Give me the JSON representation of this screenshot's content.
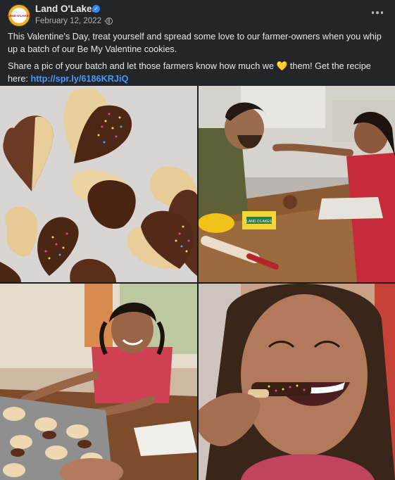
{
  "header": {
    "page_name": "Land O'Lakes",
    "avatar_text": "LAND O'LAKES",
    "date": "February 12, 2022 ·",
    "verified_icon": "verified-check-icon",
    "audience_icon": "globe-icon",
    "more_icon": "more-horizontal-icon"
  },
  "caption": {
    "line1": "This Valentine's Day, treat yourself and spread some love to our farmer-owners when you whip up a batch of our Be My Valentine cookies.",
    "line2_before": "Share a pic of your batch and let those farmers know how much we ",
    "heart_emoji": "💛",
    "line2_after": " them! Get the recipe here: ",
    "link": "http://spr.ly/6186KRJiQ"
  },
  "photos": [
    {
      "name": "heart-cookies-photo"
    },
    {
      "name": "father-daughter-kitchen-photo"
    },
    {
      "name": "girl-cookie-tray-photo"
    },
    {
      "name": "girl-eating-cookie-photo"
    }
  ],
  "product_label": "LAND O'LAKES",
  "colors": {
    "background": "#242526",
    "text": "#e4e6eb",
    "secondary": "#b0b3b8",
    "link": "#4599ff",
    "verified": "#2d88ff"
  }
}
